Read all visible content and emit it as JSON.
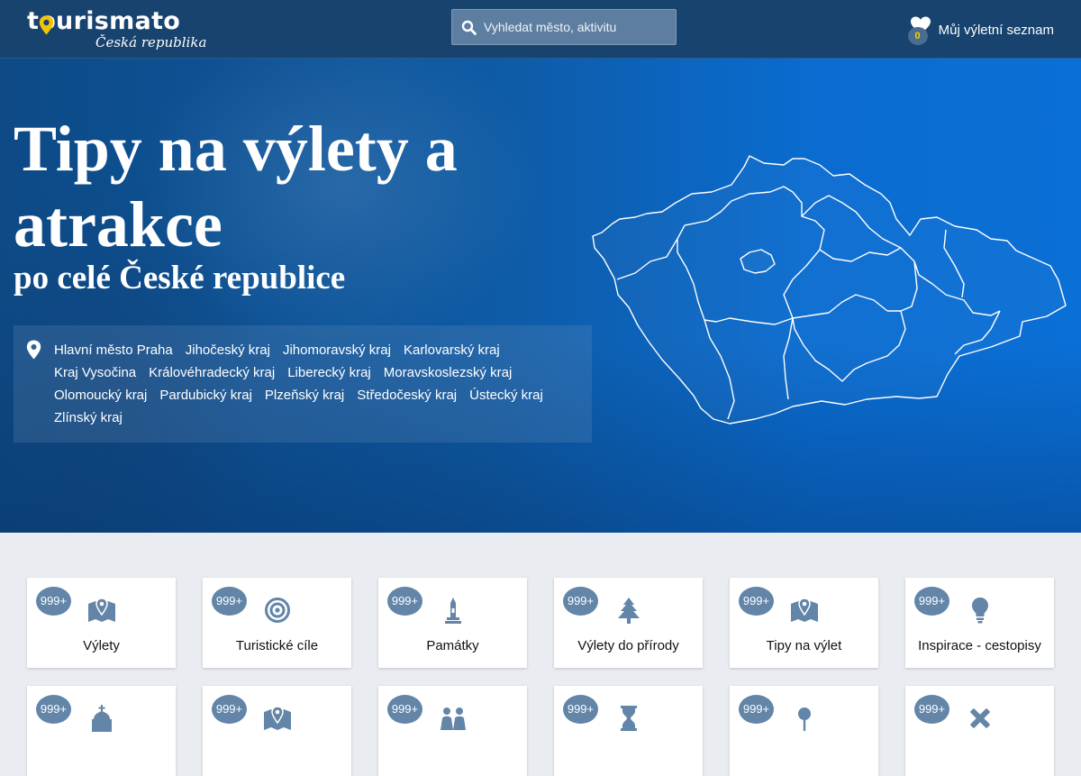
{
  "header": {
    "logo_text": "tourismato",
    "logo_subtitle": "Česká republika",
    "search": {
      "placeholder": "Vyhledat město, aktivitu",
      "value": ""
    },
    "trip_list": {
      "label": "Můj výletní seznam",
      "count": "0"
    }
  },
  "hero": {
    "title": "Tipy na výlety a atrakce",
    "subtitle": "po celé České republice",
    "regions": [
      "Hlavní město Praha",
      "Jihočeský kraj",
      "Jihomoravský kraj",
      "Karlovarský kraj",
      "Kraj Vysočina",
      "Královéhradecký kraj",
      "Liberecký kraj",
      "Moravskoslezský kraj",
      "Olomoucký kraj",
      "Pardubický kraj",
      "Plzeňský kraj",
      "Středočeský kraj",
      "Ústecký kraj",
      "Zlínský kraj"
    ]
  },
  "categories": [
    {
      "label": "Výlety",
      "count": "999+",
      "icon": "map-pin-icon"
    },
    {
      "label": "Turistické cíle",
      "count": "999+",
      "icon": "target-icon"
    },
    {
      "label": "Památky",
      "count": "999+",
      "icon": "monument-icon"
    },
    {
      "label": "Výlety do přírody",
      "count": "999+",
      "icon": "tree-icon"
    },
    {
      "label": "Tipy na výlet",
      "count": "999+",
      "icon": "map-pin-icon"
    },
    {
      "label": "Inspirace - cestopisy",
      "count": "999+",
      "icon": "lightbulb-icon"
    },
    {
      "label": "",
      "count": "999+",
      "icon": "church-icon"
    },
    {
      "label": "",
      "count": "999+",
      "icon": "map-pin-icon"
    },
    {
      "label": "",
      "count": "999+",
      "icon": "family-icon"
    },
    {
      "label": "",
      "count": "999+",
      "icon": "hourglass-icon"
    },
    {
      "label": "",
      "count": "999+",
      "icon": "pin-icon"
    },
    {
      "label": "",
      "count": "999+",
      "icon": "tools-icon"
    }
  ],
  "colors": {
    "header_bg": "#17436e",
    "hero_blue": "#0a6cd0",
    "badge": "#6285a8",
    "icon": "#6285a8",
    "page_bg": "#e9edf1"
  }
}
